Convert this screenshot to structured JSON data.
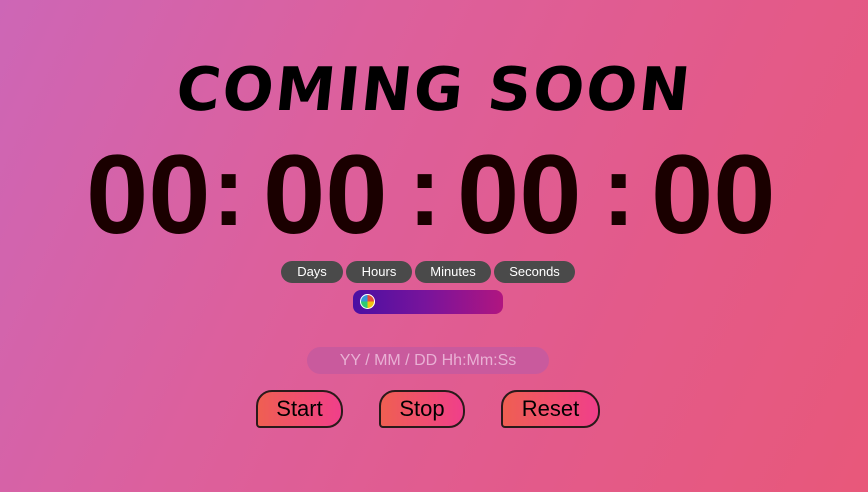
{
  "title": "COMING SOON",
  "timer": {
    "days": "00",
    "hours": "00",
    "minutes": "00",
    "seconds": "00",
    "separator": ":"
  },
  "units": {
    "days": "Days",
    "hours": "Hours",
    "minutes": "Minutes",
    "seconds": "Seconds"
  },
  "date_input": {
    "placeholder": "YY / MM / DD Hh:Mm:Ss",
    "value": ""
  },
  "buttons": {
    "start": "Start",
    "stop": "Stop",
    "reset": "Reset"
  },
  "colors": {
    "background_start": "#cd66b6",
    "background_end": "#e8587a",
    "digits": "#1a0000",
    "pill": "#4a4a4a",
    "button_gradient_start": "#ef5f52",
    "button_gradient_end": "#f03f8a"
  },
  "icons": {
    "theme_toggle_knob": "color-wheel-icon"
  }
}
